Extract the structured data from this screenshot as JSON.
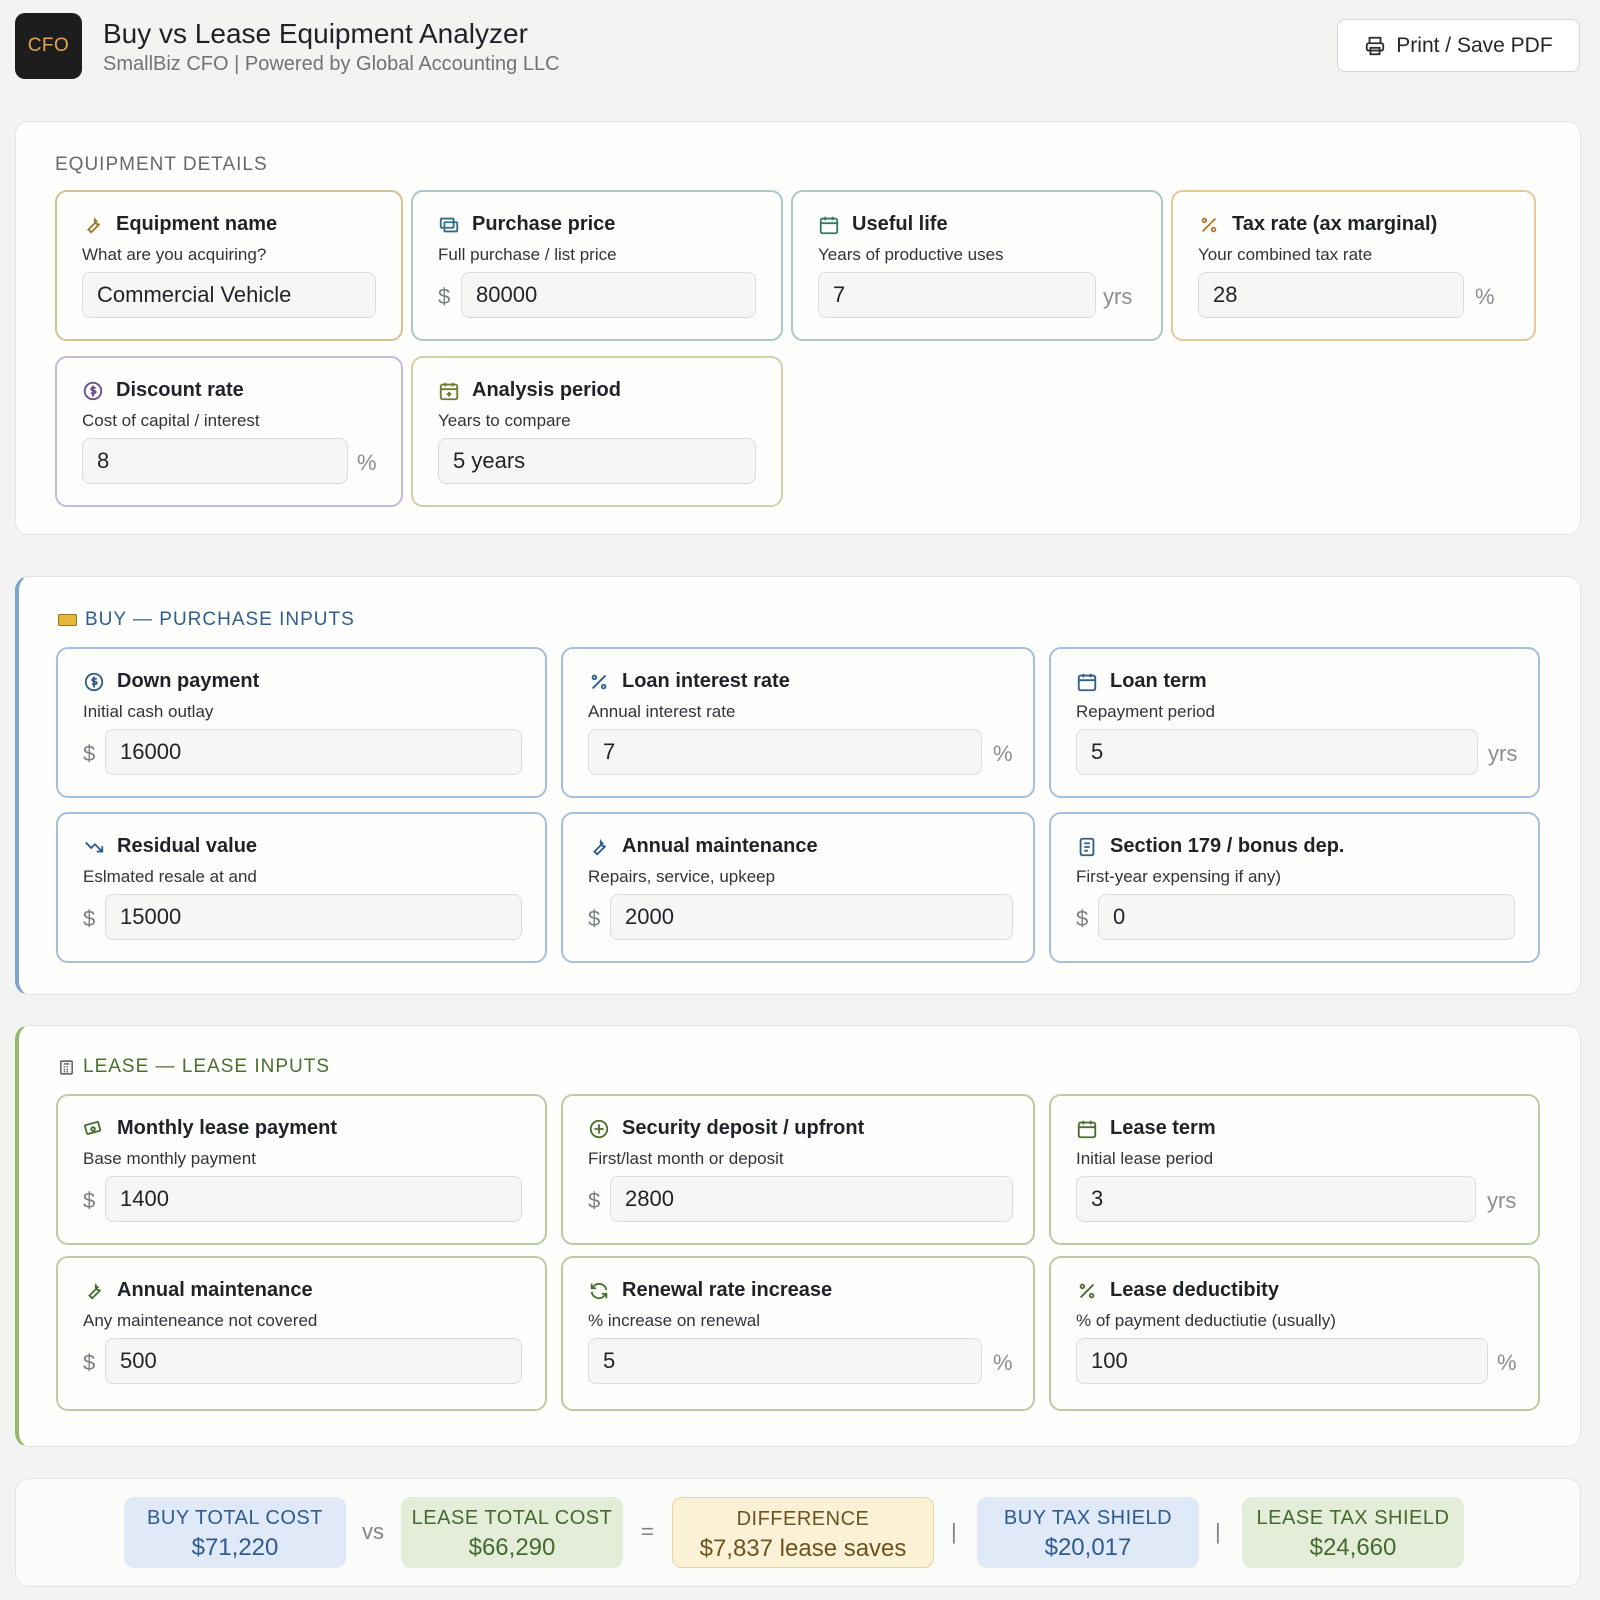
{
  "header": {
    "logo": "CFO",
    "title": "Buy vs Lease Equipment Analyzer",
    "subtitle": "SmallBiz CFO | Powered by Global Accounting LLC",
    "print_label": "Print / Save PDF"
  },
  "equipment": {
    "heading": "EQUIPMENT DETAILS",
    "name": {
      "title": "Equipment name",
      "desc": "What are you acquiring?",
      "value": "Commercial Vehicle"
    },
    "price": {
      "title": "Purchase price",
      "desc": "Full purchase / list price",
      "prefix": "$",
      "value": "80000"
    },
    "life": {
      "title": "Useful life",
      "desc": "Years of productive uses",
      "value": "7",
      "suffix": "yrs"
    },
    "tax": {
      "title": "Tax rate (ax marginal)",
      "desc": "Your combined tax rate",
      "value": "28",
      "suffix": "%"
    },
    "discount": {
      "title": "Discount rate",
      "desc": "Cost of capital / interest",
      "value": "8",
      "suffix": "%"
    },
    "period": {
      "title": "Analysis period",
      "desc": "Years to compare",
      "value": "5 years"
    }
  },
  "buy": {
    "heading": "BUY — PURCHASE INPUTS",
    "down": {
      "title": "Down payment",
      "desc": "Initial cash outlay",
      "prefix": "$",
      "value": "16000"
    },
    "rate": {
      "title": "Loan interest rate",
      "desc": "Annual interest rate",
      "value": "7",
      "suffix": "%"
    },
    "term": {
      "title": "Loan term",
      "desc": "Repayment period",
      "value": "5",
      "suffix": "yrs"
    },
    "residual": {
      "title": "Residual value",
      "desc": "Eslmated resale at and",
      "prefix": "$",
      "value": "15000"
    },
    "maint": {
      "title": "Annual maintenance",
      "desc": "Repairs, service, upkeep",
      "prefix": "$",
      "value": "2000"
    },
    "sec179": {
      "title": "Section 179 / bonus dep.",
      "desc": "First-year expensing if any)",
      "prefix": "$",
      "value": "0"
    }
  },
  "lease": {
    "heading": "LEASE — LEASE INPUTS",
    "monthly": {
      "title": "Monthly lease payment",
      "desc": "Base monthly payment",
      "prefix": "$",
      "value": "1400"
    },
    "deposit": {
      "title": "Security deposit / upfront",
      "desc": "First/last month or deposit",
      "prefix": "$",
      "value": "2800"
    },
    "term": {
      "title": "Lease term",
      "desc": "Initial lease period",
      "value": "3",
      "suffix": "yrs"
    },
    "maint": {
      "title": "Annual maintenance",
      "desc": "Any mainteneance not covered",
      "prefix": "$",
      "value": "500"
    },
    "renewal": {
      "title": "Renewal rate increase",
      "desc": "% increase on renewal",
      "value": "5",
      "suffix": "%"
    },
    "deduct": {
      "title": "Lease deductibity",
      "desc": "% of payment deductiutie (usually)",
      "value": "100",
      "suffix": "%"
    }
  },
  "summary": {
    "buy_total": {
      "label": "BUY TOTAL COST",
      "value": "$71,220"
    },
    "vs": "vs",
    "lease_total": {
      "label": "LEASE TOTAL COST",
      "value": "$66,290"
    },
    "equals": "=",
    "difference": {
      "label": "DIFFERENCE",
      "value": "$7,837 lease saves"
    },
    "bar1": "|",
    "buy_shield": {
      "label": "BUY TAX SHIELD",
      "value": "$20,017"
    },
    "bar2": "|",
    "lease_shield": {
      "label": "LEASE TAX SHIELD",
      "value": "$24,660"
    }
  },
  "colors": {
    "buy_accent": "#7fa4d3",
    "lease_accent": "#93b86d",
    "difference_accent": "#ecd49a"
  },
  "icons": {
    "print": "printer-icon",
    "equipment_name": "wrench-icon",
    "purchase_price": "money-icon",
    "useful_life": "calendar-icon",
    "tax_rate": "percent-icon",
    "discount_rate": "dollar-circle-icon",
    "analysis_period": "calendar-plus-icon",
    "buy_section": "card-icon",
    "lease_section": "calculator-icon"
  }
}
